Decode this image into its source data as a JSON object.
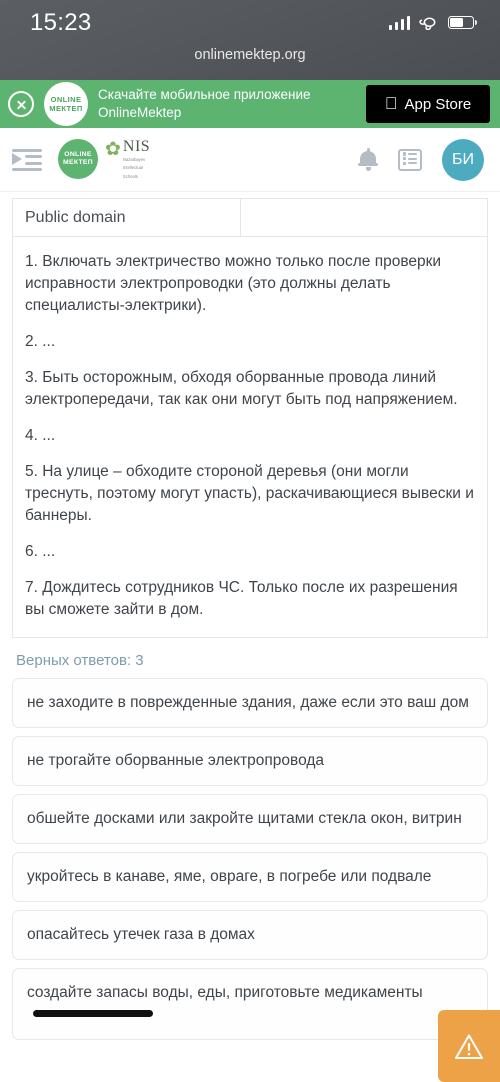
{
  "status_bar": {
    "time": "15:23",
    "signal_icon": "signal-bars-icon",
    "vpn_icon": "link-chain-icon",
    "battery_icon": "battery-icon"
  },
  "browser": {
    "url": "onlinemektep.org"
  },
  "promo_banner": {
    "close_icon": "close-circle-icon",
    "logo_line1": "ONLINE",
    "logo_line2": "МЕКТЕП",
    "text_line1": "Скачайте мобильное приложение",
    "text_line2": "OnlineMektep",
    "app_store_label": "App Store",
    "apple_glyph": "",
    "background_color": "#5cb470"
  },
  "app_header": {
    "menu_icon": "sidebar-expand-icon",
    "brand_om_line1": "ONLINE",
    "brand_om_line2": "МЕКТЕП",
    "brand_nis_title": "NIS",
    "brand_nis_sub1": "Nazarbayev",
    "brand_nis_sub2": "Intellectual",
    "brand_nis_sub3": "Schools",
    "notifications_icon": "bell-icon",
    "list_icon": "list-icon",
    "avatar_initials": "БИ",
    "avatar_color": "#4cabbf"
  },
  "table": {
    "row": {
      "cell_left": "Public domain",
      "cell_right": ""
    }
  },
  "passage": {
    "paragraphs": [
      "1. Включать электричество можно только после проверки исправности электропроводки (это должны делать специалисты-электрики).",
      "2. ...",
      "3. Быть осторожным, обходя оборванные провода линий электропередачи, так как они могут быть под напряжением.",
      "4. ...",
      "5. На улице – обходите стороной деревья (они могли треснуть, поэтому могут упасть), раскачивающиеся вывески и баннеры.",
      "6. ...",
      "7. Дождитесь сотрудников ЧС. Только после их разрешения вы сможете зайти в дом."
    ]
  },
  "answers": {
    "correct_count_label": "Верных ответов: 3",
    "correct_count_color": "#7e9bb0",
    "options": [
      {
        "text": "не заходите в поврежденные здания, даже если это ваш дом",
        "redacted": false
      },
      {
        "text": "не трогайте оборванные электропровода",
        "redacted": false
      },
      {
        "text": "обшейте досками или закройте щитами стекла окон, витрин",
        "redacted": false
      },
      {
        "text": "укройтесь в канаве, яме, овраге, в погребе или подвале",
        "redacted": false
      },
      {
        "text": "опасайтесь утечек газа в домах",
        "redacted": false
      },
      {
        "text": "создайте запасы воды, еды, приготовьте медикаменты",
        "redacted": true
      }
    ]
  },
  "floating_button": {
    "icon": "warning-triangle-icon",
    "color": "#eda248"
  }
}
